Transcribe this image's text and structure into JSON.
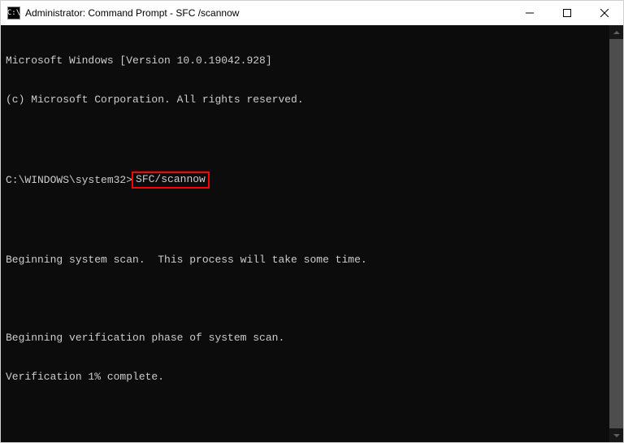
{
  "titlebar": {
    "icon_text": "C:\\",
    "title": "Administrator: Command Prompt - SFC /scannow"
  },
  "console": {
    "line1": "Microsoft Windows [Version 10.0.19042.928]",
    "line2": "(c) Microsoft Corporation. All rights reserved.",
    "prompt": "C:\\WINDOWS\\system32>",
    "command": "SFC/scannow",
    "line3": "Beginning system scan.  This process will take some time.",
    "line4": "Beginning verification phase of system scan.",
    "line5": "Verification 1% complete."
  }
}
